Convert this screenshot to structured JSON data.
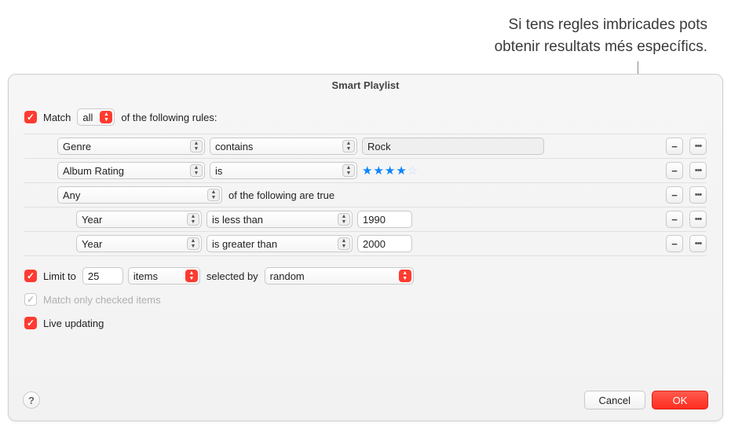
{
  "annotation": {
    "line1": "Si tens regles imbricades pots",
    "line2": "obtenir resultats més específics."
  },
  "dialog": {
    "title": "Smart Playlist",
    "match": {
      "label_prefix": "Match",
      "mode": "all",
      "label_suffix": "of the following rules:"
    },
    "rules": [
      {
        "attribute": "Genre",
        "operator": "contains",
        "value": "Rock"
      },
      {
        "attribute": "Album Rating",
        "operator": "is",
        "rating_filled": 4,
        "rating_total": 5
      },
      {
        "nest_mode": "Any",
        "nest_suffix": "of the following are true"
      },
      {
        "attribute": "Year",
        "operator": "is less than",
        "value": "1990",
        "nested": true
      },
      {
        "attribute": "Year",
        "operator": "is greater than",
        "value": "2000",
        "nested": true
      }
    ],
    "limit": {
      "label": "Limit to",
      "count": "25",
      "unit": "items",
      "selected_by_label": "selected by",
      "selected_by_value": "random"
    },
    "match_checked": {
      "label": "Match only checked items"
    },
    "live_updating": {
      "label": "Live updating"
    },
    "buttons": {
      "help": "?",
      "cancel": "Cancel",
      "ok": "OK"
    }
  }
}
